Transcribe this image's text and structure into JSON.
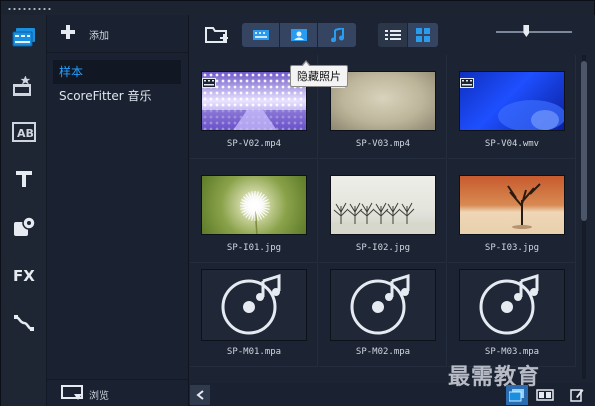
{
  "library": {
    "add_label": "添加",
    "items": [
      {
        "label": "样本",
        "selected": true
      },
      {
        "label": "ScoreFitter 音乐",
        "selected": false
      }
    ],
    "browse_label": "浏览"
  },
  "rail_icons": [
    "media-icon",
    "instant-project-icon",
    "title-ab-icon",
    "text-t-icon",
    "transition-icon",
    "fx-icon",
    "path-icon"
  ],
  "toolbar": {
    "tooltip": "隐藏照片",
    "filters": [
      "show-video-icon",
      "show-photo-icon",
      "show-audio-icon"
    ],
    "views": [
      "list-view-icon",
      "thumbnail-view-icon"
    ],
    "zoom_level": 0.4
  },
  "media": [
    {
      "name": "SP-V02.mp4",
      "kind": "video",
      "thumb": "v02"
    },
    {
      "name": "SP-V03.mp4",
      "kind": "video",
      "thumb": "v03"
    },
    {
      "name": "SP-V04.wmv",
      "kind": "video",
      "thumb": "v04"
    },
    {
      "name": "SP-I01.jpg",
      "kind": "image",
      "thumb": "i01"
    },
    {
      "name": "SP-I02.jpg",
      "kind": "image",
      "thumb": "i02"
    },
    {
      "name": "SP-I03.jpg",
      "kind": "image",
      "thumb": "i03"
    },
    {
      "name": "SP-M01.mpa",
      "kind": "audio",
      "thumb": "m"
    },
    {
      "name": "SP-M02.mpa",
      "kind": "audio",
      "thumb": "m"
    },
    {
      "name": "SP-M03.mpa",
      "kind": "audio",
      "thumb": "m"
    }
  ],
  "watermark": "最需教育",
  "colors": {
    "accent": "#1a8fe0",
    "selected_text": "#26a0ff",
    "background": "#1c2331"
  }
}
